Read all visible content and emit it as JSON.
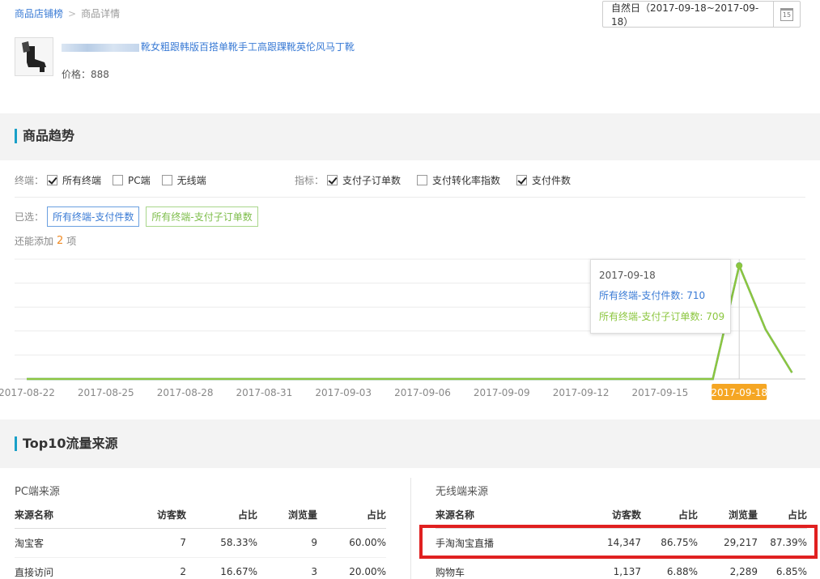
{
  "breadcrumb": {
    "parent": "商品店铺榜",
    "sep": ">",
    "current": "商品详情"
  },
  "date_range": {
    "label": "自然日（2017-09-18~2017-09-18）",
    "calendar_day": "15"
  },
  "product": {
    "title": "靴女粗跟韩版百搭单靴手工高跟踝靴英伦风马丁靴",
    "price_label": "价格：",
    "price": "888"
  },
  "trend": {
    "title": "商品趋势",
    "terminal_label": "终端：",
    "terminals": [
      {
        "label": "所有终端",
        "checked": true
      },
      {
        "label": "PC端",
        "checked": false
      },
      {
        "label": "无线端",
        "checked": false
      }
    ],
    "metric_label": "指标：",
    "metrics": [
      {
        "label": "支付子订单数",
        "checked": true
      },
      {
        "label": "支付转化率指数",
        "checked": false
      },
      {
        "label": "支付件数",
        "checked": true
      }
    ],
    "selected_label": "已选：",
    "selected": [
      "所有终端-支付件数",
      "所有终端-支付子订单数"
    ],
    "add_more_prefix": "还能添加",
    "add_more_count": "2",
    "add_more_suffix": "项"
  },
  "tooltip": {
    "date": "2017-09-18",
    "line1": "所有终端-支付件数: 710",
    "line2": "所有终端-支付子订单数: 709"
  },
  "chart_data": {
    "type": "line",
    "x": [
      "2017-08-20",
      "2017-08-21",
      "2017-08-22",
      "2017-08-23",
      "2017-08-24",
      "2017-08-25",
      "2017-08-26",
      "2017-08-27",
      "2017-08-28",
      "2017-08-29",
      "2017-08-30",
      "2017-08-31",
      "2017-09-01",
      "2017-09-02",
      "2017-09-03",
      "2017-09-04",
      "2017-09-05",
      "2017-09-06",
      "2017-09-07",
      "2017-09-08",
      "2017-09-09",
      "2017-09-10",
      "2017-09-11",
      "2017-09-12",
      "2017-09-13",
      "2017-09-14",
      "2017-09-15",
      "2017-09-16",
      "2017-09-17",
      "2017-09-18",
      "2017-09-19",
      "2017-09-20"
    ],
    "xticks": [
      "2017-08-22",
      "2017-08-25",
      "2017-08-28",
      "2017-08-31",
      "2017-09-03",
      "2017-09-06",
      "2017-09-09",
      "2017-09-12",
      "2017-09-15",
      "2017-09-18"
    ],
    "highlight_tick": "2017-09-18",
    "series": [
      {
        "name": "所有终端-支付件数",
        "color": "#3a7bd5",
        "values": [
          0,
          0,
          0,
          0,
          0,
          0,
          0,
          0,
          0,
          0,
          0,
          0,
          0,
          0,
          0,
          0,
          0,
          0,
          0,
          0,
          0,
          0,
          0,
          0,
          0,
          0,
          0,
          0,
          0,
          710,
          310,
          40
        ]
      },
      {
        "name": "所有终端-支付子订单数",
        "color": "#8cc63f",
        "values": [
          0,
          0,
          0,
          0,
          0,
          0,
          0,
          0,
          0,
          0,
          0,
          0,
          0,
          0,
          0,
          0,
          0,
          0,
          0,
          0,
          0,
          0,
          0,
          0,
          0,
          0,
          0,
          0,
          0,
          709,
          310,
          40
        ]
      }
    ],
    "ylim": [
      0,
      750
    ],
    "grid": true,
    "title": "",
    "xlabel": "",
    "ylabel": ""
  },
  "top10": {
    "title": "Top10流量来源",
    "pc": {
      "title": "PC端来源",
      "headers": [
        "来源名称",
        "访客数",
        "占比",
        "浏览量",
        "占比"
      ],
      "rows": [
        [
          "淘宝客",
          "7",
          "58.33%",
          "9",
          "60.00%"
        ],
        [
          "直接访问",
          "2",
          "16.67%",
          "3",
          "20.00%"
        ]
      ]
    },
    "mobile": {
      "title": "无线端来源",
      "headers": [
        "来源名称",
        "访客数",
        "占比",
        "浏览量",
        "占比"
      ],
      "rows": [
        [
          "手淘淘宝直播",
          "14,347",
          "86.75%",
          "29,217",
          "87.39%"
        ],
        [
          "购物车",
          "1,137",
          "6.88%",
          "2,289",
          "6.85%"
        ]
      ]
    }
  }
}
